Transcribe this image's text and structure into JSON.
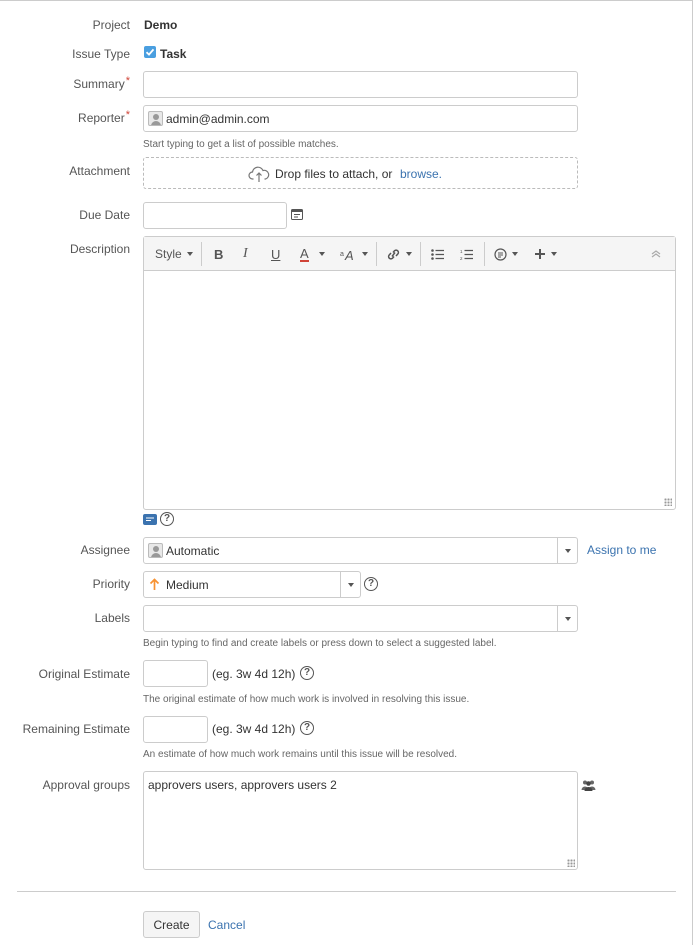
{
  "fields": {
    "project": {
      "label": "Project",
      "value": "Demo"
    },
    "issue_type": {
      "label": "Issue Type",
      "value": "Task"
    },
    "summary": {
      "label": "Summary",
      "required_mark": "*",
      "value": ""
    },
    "reporter": {
      "label": "Reporter",
      "required_mark": "*",
      "value": "admin@admin.com",
      "hint": "Start typing to get a list of possible matches."
    },
    "attachment": {
      "label": "Attachment",
      "drop_text": "Drop files to attach, or",
      "browse_link": "browse."
    },
    "due_date": {
      "label": "Due Date",
      "value": ""
    },
    "description": {
      "label": "Description",
      "toolbar": {
        "style": "Style",
        "bold": "B",
        "italic": "I",
        "underline": "U",
        "text_color": "A"
      },
      "value": ""
    },
    "assignee": {
      "label": "Assignee",
      "value": "Automatic",
      "assign_link": "Assign to me"
    },
    "priority": {
      "label": "Priority",
      "value": "Medium",
      "color": "#f79232"
    },
    "labels": {
      "label": "Labels",
      "value": "",
      "hint": "Begin typing to find and create labels or press down to select a suggested label."
    },
    "original_estimate": {
      "label": "Original Estimate",
      "value": "",
      "example": "(eg. 3w 4d 12h)",
      "hint": "The original estimate of how much work is involved in resolving this issue."
    },
    "remaining_estimate": {
      "label": "Remaining Estimate",
      "value": "",
      "example": "(eg. 3w 4d 12h)",
      "hint": "An estimate of how much work remains until this issue will be resolved."
    },
    "approval_groups": {
      "label": "Approval groups",
      "value": "approvers users, approvers users 2"
    }
  },
  "actions": {
    "create": "Create",
    "cancel": "Cancel"
  },
  "icons": {
    "help": "?",
    "task": "task-checkbox-icon",
    "upload": "cloud-upload-icon",
    "calendar": "calendar-icon",
    "groups": "user-group-icon"
  },
  "colors": {
    "accent": "#3b73af",
    "required": "#d04437",
    "task_icon": "#4a9fe0",
    "text_color_underline": "#d04437"
  }
}
